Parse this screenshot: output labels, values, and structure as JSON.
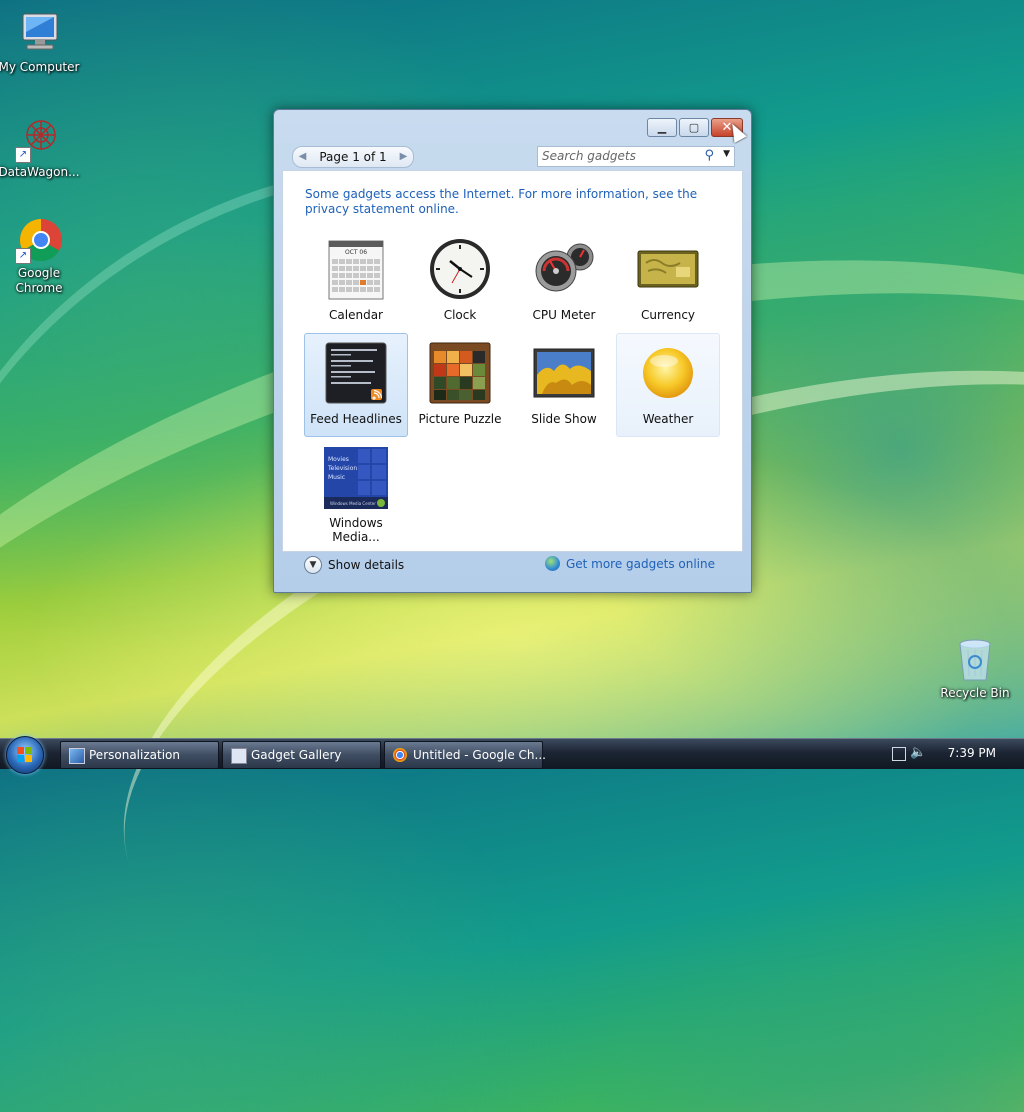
{
  "desktop": {
    "icons": [
      {
        "label": "My Computer"
      },
      {
        "label": "DataWagon..."
      },
      {
        "label": "Google Chrome"
      },
      {
        "label": "Recycle Bin"
      }
    ]
  },
  "window": {
    "pager_label": "Page 1 of 1",
    "search_placeholder": "Search gadgets",
    "notice": "Some gadgets access the Internet.  For more information, see the privacy statement online.",
    "gadgets": [
      {
        "name": "Calendar"
      },
      {
        "name": "Clock"
      },
      {
        "name": "CPU Meter"
      },
      {
        "name": "Currency"
      },
      {
        "name": "Feed Headlines"
      },
      {
        "name": "Picture Puzzle"
      },
      {
        "name": "Slide Show"
      },
      {
        "name": "Weather"
      },
      {
        "name": "Windows Media..."
      }
    ],
    "calendar_month": "OCT 06",
    "wmc_items": [
      "Movies",
      "Television",
      "Music"
    ],
    "wmc_bar": "Windows Media Center",
    "footer": {
      "show_details": "Show details",
      "get_more": "Get more gadgets online"
    }
  },
  "taskbar": {
    "tasks": [
      {
        "label": "Personalization"
      },
      {
        "label": "Gadget Gallery"
      },
      {
        "label": "Untitled - Google Ch..."
      }
    ],
    "time": "7:39 PM"
  },
  "colors": {
    "link": "#1f61b8",
    "selection": "#cfe3f8"
  }
}
